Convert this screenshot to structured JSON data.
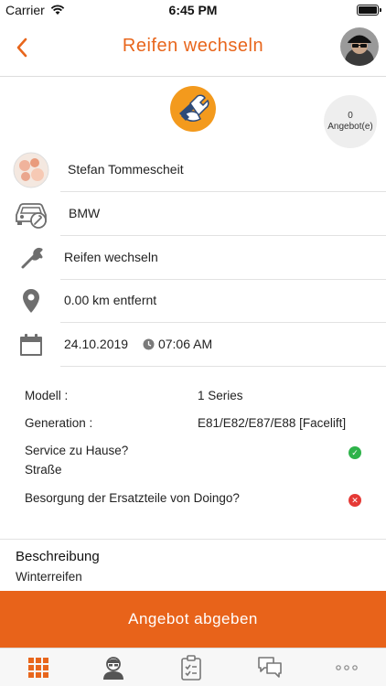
{
  "status_bar": {
    "carrier": "Carrier",
    "time": "6:45 PM"
  },
  "nav": {
    "title": "Reifen wechseln",
    "back_icon": "chevron-left-icon",
    "avatar": "user-avatar"
  },
  "header": {
    "service_icon": "wrench-hand-icon",
    "offer_badge": "0 Angebot(e)"
  },
  "info_rows": {
    "customer": "Stefan Tommescheit",
    "car_brand": "BMW",
    "service": "Reifen wechseln",
    "distance": "0.00 km entfernt",
    "date": "24.10.2019",
    "time": "07:06 AM"
  },
  "details": {
    "model_label": "Modell :",
    "model_value": "1 Series",
    "generation_label": "Generation :",
    "generation_value": "E81/E82/E87/E88 [Facelift]",
    "home_service_label": "Service zu Hause?",
    "home_service_sub": "Straße",
    "home_service_status": "yes",
    "parts_label": "Besorgung der Ersatzteile von Doingo?",
    "parts_status": "no"
  },
  "description": {
    "title": "Beschreibung",
    "text": "Winterreifen"
  },
  "cta": {
    "label": "Angebot abgeben"
  },
  "tabbar": {
    "tabs": [
      "grid-icon",
      "profile-icon",
      "clipboard-icon",
      "chat-icon",
      "more-icon"
    ]
  },
  "colors": {
    "accent": "#e8661c",
    "success": "#2eb34a",
    "error": "#e53935"
  }
}
